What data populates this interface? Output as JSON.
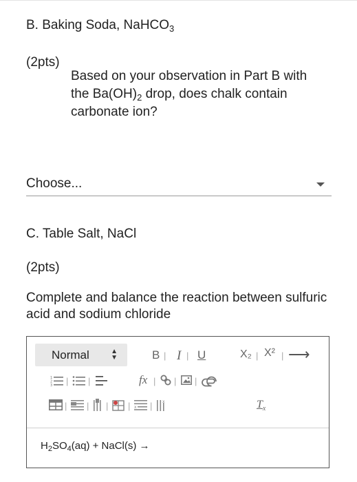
{
  "section_b": {
    "title_text": "B. Baking Soda, NaHCO",
    "title_sub": "3",
    "points": "(2pts)",
    "question_part1": "Based on your observation in Part B with the Ba(OH)",
    "question_sub": "2",
    "question_part2": " drop, does chalk contain carbonate ion?"
  },
  "dropdown": {
    "value": "Choose..."
  },
  "section_c": {
    "title": "C. Table Salt, NaCl",
    "points": "(2pts)",
    "question": "Complete and balance the reaction between sulfuric acid and sodium chloride"
  },
  "editor": {
    "style_value": "Normal",
    "bold": "B",
    "italic": "I",
    "underline": "U",
    "subscript": "X₂",
    "superscript": "X²",
    "arrow": "⟶",
    "formula": "fx",
    "clear_format": "Tx",
    "content_part1": "H",
    "content_sub1": "2",
    "content_part2": "SO",
    "content_sub2": "4",
    "content_part3": "(aq) + NaCl(s) →"
  }
}
